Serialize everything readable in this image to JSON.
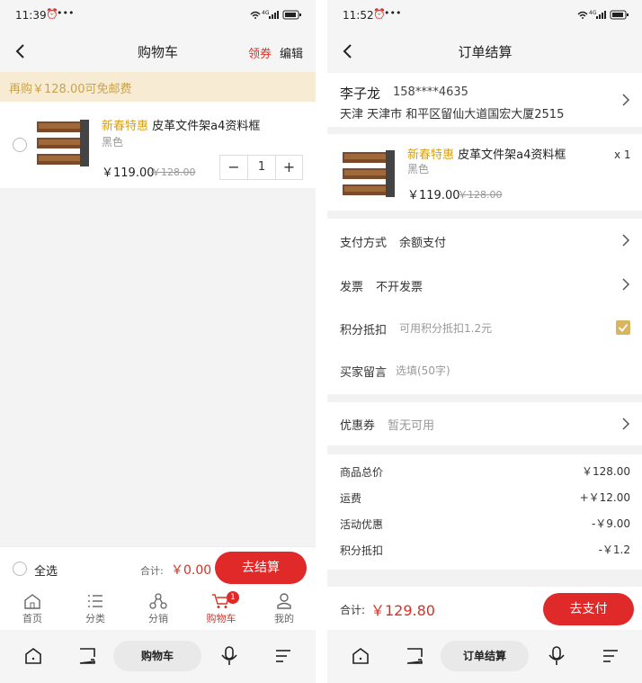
{
  "cart": {
    "status": {
      "time": "11:39",
      "alarm": "⏰",
      "dots": "•••",
      "network": "⁴ᴳ"
    },
    "nav": {
      "back": "back",
      "title": "购物车",
      "coupon_link": "领券",
      "edit_link": "编辑"
    },
    "notice": "再购￥128.00可免邮费",
    "item": {
      "promo": "新春特惠",
      "name": "皮革文件架a4资料框",
      "variant": "黑色",
      "price": "￥119.00",
      "original_price": "￥128.00",
      "quantity": "1",
      "minus": "−",
      "plus": "+"
    },
    "footer": {
      "select_all": "全选",
      "total_label": "合计:",
      "total_value": "￥0.00",
      "checkout": "去结算"
    },
    "tabs": [
      {
        "label": "首页",
        "icon": "home-icon"
      },
      {
        "label": "分类",
        "icon": "list-icon"
      },
      {
        "label": "分销",
        "icon": "share-network-icon"
      },
      {
        "label": "购物车",
        "icon": "cart-icon",
        "badge": "1",
        "active": true
      },
      {
        "label": "我的",
        "icon": "user-icon"
      }
    ],
    "sysnav_title": "购物车"
  },
  "order": {
    "status": {
      "time": "11:52",
      "alarm": "⏰",
      "dots": "•••",
      "network": "⁴ᴳ"
    },
    "nav": {
      "back": "back",
      "title": "订单结算"
    },
    "address": {
      "name": "李子龙",
      "phone": "158****4635",
      "detail": "天津 天津市 和平区留仙大道国宏大厦2515"
    },
    "item": {
      "promo": "新春特惠",
      "name": "皮革文件架a4资料框",
      "variant": "黑色",
      "price": "￥119.00",
      "original_price": "￥128.00",
      "qty": "x 1"
    },
    "options": {
      "payment_label": "支付方式",
      "payment_value": "余额支付",
      "invoice_label": "发票",
      "invoice_value": "不开发票",
      "points_label": "积分抵扣",
      "points_value": "可用积分抵扣1.2元",
      "message_label": "买家留言",
      "message_placeholder": "选填(50字)"
    },
    "coupon": {
      "label": "优惠券",
      "value": "暂无可用"
    },
    "summary": {
      "goods_label": "商品总价",
      "goods_value": "￥128.00",
      "shipping_label": "运费",
      "shipping_value": "+￥12.00",
      "discount_label": "活动优惠",
      "discount_value": "-￥9.00",
      "points_label": "积分抵扣",
      "points_value": "-￥1.2"
    },
    "footer": {
      "total_label": "合计:",
      "total_value": "￥129.80",
      "pay": "去支付"
    },
    "sysnav_title": "订单结算"
  },
  "colors": {
    "accent_red": "#e02a2a",
    "promo_gold": "#d4a017",
    "notice_bg": "#f7ecd3",
    "checkbox_gold": "#d8b55e"
  }
}
